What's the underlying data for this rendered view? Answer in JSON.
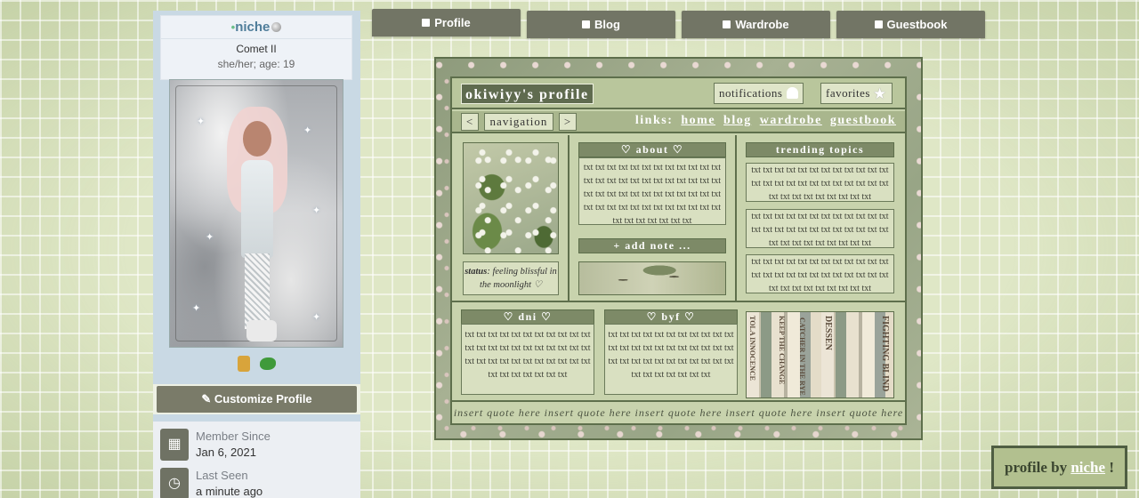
{
  "sidebar": {
    "username": "niche",
    "level": "Comet II",
    "pronouns": "she/her; age: 19",
    "customize_label": "Customize Profile",
    "member_since_label": "Member Since",
    "member_since_value": "Jan 6, 2021",
    "last_seen_label": "Last Seen",
    "last_seen_value": "a minute ago"
  },
  "tabs": [
    {
      "label": "Profile",
      "icon": "person-icon"
    },
    {
      "label": "Blog",
      "icon": "document-icon"
    },
    {
      "label": "Wardrobe",
      "icon": "wardrobe-icon"
    },
    {
      "label": "Guestbook",
      "icon": "guestbook-icon"
    }
  ],
  "profile": {
    "title": "okiwiyy's profile",
    "notifications_label": "notifications",
    "favorites_label": "favorites",
    "nav_prev": "<",
    "nav_label": "navigation",
    "nav_next": ">",
    "links_label": "links:",
    "links": [
      "home",
      "blog",
      "wardrobe",
      "guestbook"
    ],
    "about_header": "♡ about ♡",
    "about_text": "txt txt txt txt txt txt txt txt txt txt txt txt txt txt txt txt txt txt txt txt txt txt txt txt txt txt txt txt txt txt txt txt txt txt txt txt txt txt txt txt txt txt txt txt txt txt txt txt txt txt txt txt txt txt txt",
    "add_note_label": "+ add note ...",
    "status_label": "status",
    "status_text": ": feeling blissful in the moonlight ♡",
    "trending_header": "trending topics",
    "trending_text": "txt txt txt txt txt txt txt txt txt txt txt txt txt txt txt txt txt txt txt txt txt txt txt txt txt txt txt txt txt txt txt txt txt",
    "dni_header": "♡ dni ♡",
    "byf_header": "♡ byf ♡",
    "dni_text": "txt txt txt txt txt txt txt txt txt txt txt txt txt txt txt txt txt txt txt txt txt txt txt txt txt txt txt txt txt txt txt txt txt txt txt txt txt txt txt txt",
    "byf_text": "txt txt txt txt txt txt txt txt txt txt txt txt txt txt txt txt txt txt txt txt txt txt txt txt txt txt txt txt txt txt txt txt txt txt txt txt txt txt txt txt",
    "book_titles": [
      "TOLA INNOCENCE",
      "KEEP THE CHANGE",
      "CATCHER IN THE RYE",
      "DESSEN",
      "FIGHTING BLIND"
    ],
    "quote": "insert quote here insert quote here insert quote here insert quote here insert quote here"
  },
  "credit": {
    "prefix": "profile by",
    "name": "niche",
    "suffix": "!"
  },
  "colors": {
    "page_bg": "#dfe7c6",
    "tab_bg": "#727565",
    "layout_border": "#5e6f4c",
    "panel_bg": "#c8d3ad",
    "sidebar_bg": "#c9d9e4",
    "username_color": "#4f7d9a"
  }
}
